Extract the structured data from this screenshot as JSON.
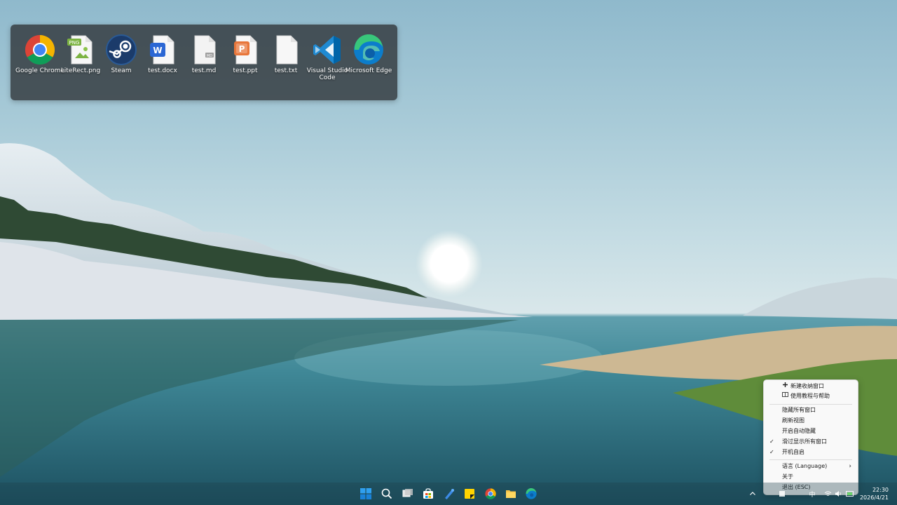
{
  "desktop": {
    "fence": {
      "items": [
        {
          "label": "Google Chrome",
          "icon": "chrome-icon"
        },
        {
          "label": "LiteRect.png",
          "icon": "png-file-icon",
          "badge": "PNG"
        },
        {
          "label": "Steam",
          "icon": "steam-icon"
        },
        {
          "label": "test.docx",
          "icon": "word-file-icon",
          "badge": "W"
        },
        {
          "label": "test.md",
          "icon": "markdown-file-icon",
          "badge": "MD"
        },
        {
          "label": "test.ppt",
          "icon": "powerpoint-file-icon",
          "badge": "P"
        },
        {
          "label": "test.txt",
          "icon": "text-file-icon"
        },
        {
          "label": "Visual Studio Code",
          "icon": "vscode-icon"
        },
        {
          "label": "Microsoft Edge",
          "icon": "edge-icon"
        }
      ]
    }
  },
  "context_menu": {
    "new_fence": "新建收纳窗口",
    "help": "使用教程与帮助",
    "hide_all": "隐藏所有窗口",
    "refresh": "刷新视图",
    "auto_hide": "开启自动隐藏",
    "scroll_show_all": "滑过显示所有窗口",
    "autostart": "开机自启",
    "language": "语言 (Language)",
    "about": "关于",
    "exit": "退出 (ESC)",
    "checked": [
      "scroll_show_all",
      "autostart"
    ]
  },
  "taskbar": {
    "apps": [
      "start-icon",
      "search-icon",
      "task-view-icon",
      "store-icon",
      "pen-app-icon",
      "sticky-notes-icon",
      "chrome-icon",
      "file-explorer-icon",
      "edge-icon"
    ],
    "tray_ime": "中",
    "time": "22:30",
    "date": "2026/4/21"
  },
  "colors": {
    "fence_bg": "#303438",
    "accent_blue": "#0078d4"
  }
}
